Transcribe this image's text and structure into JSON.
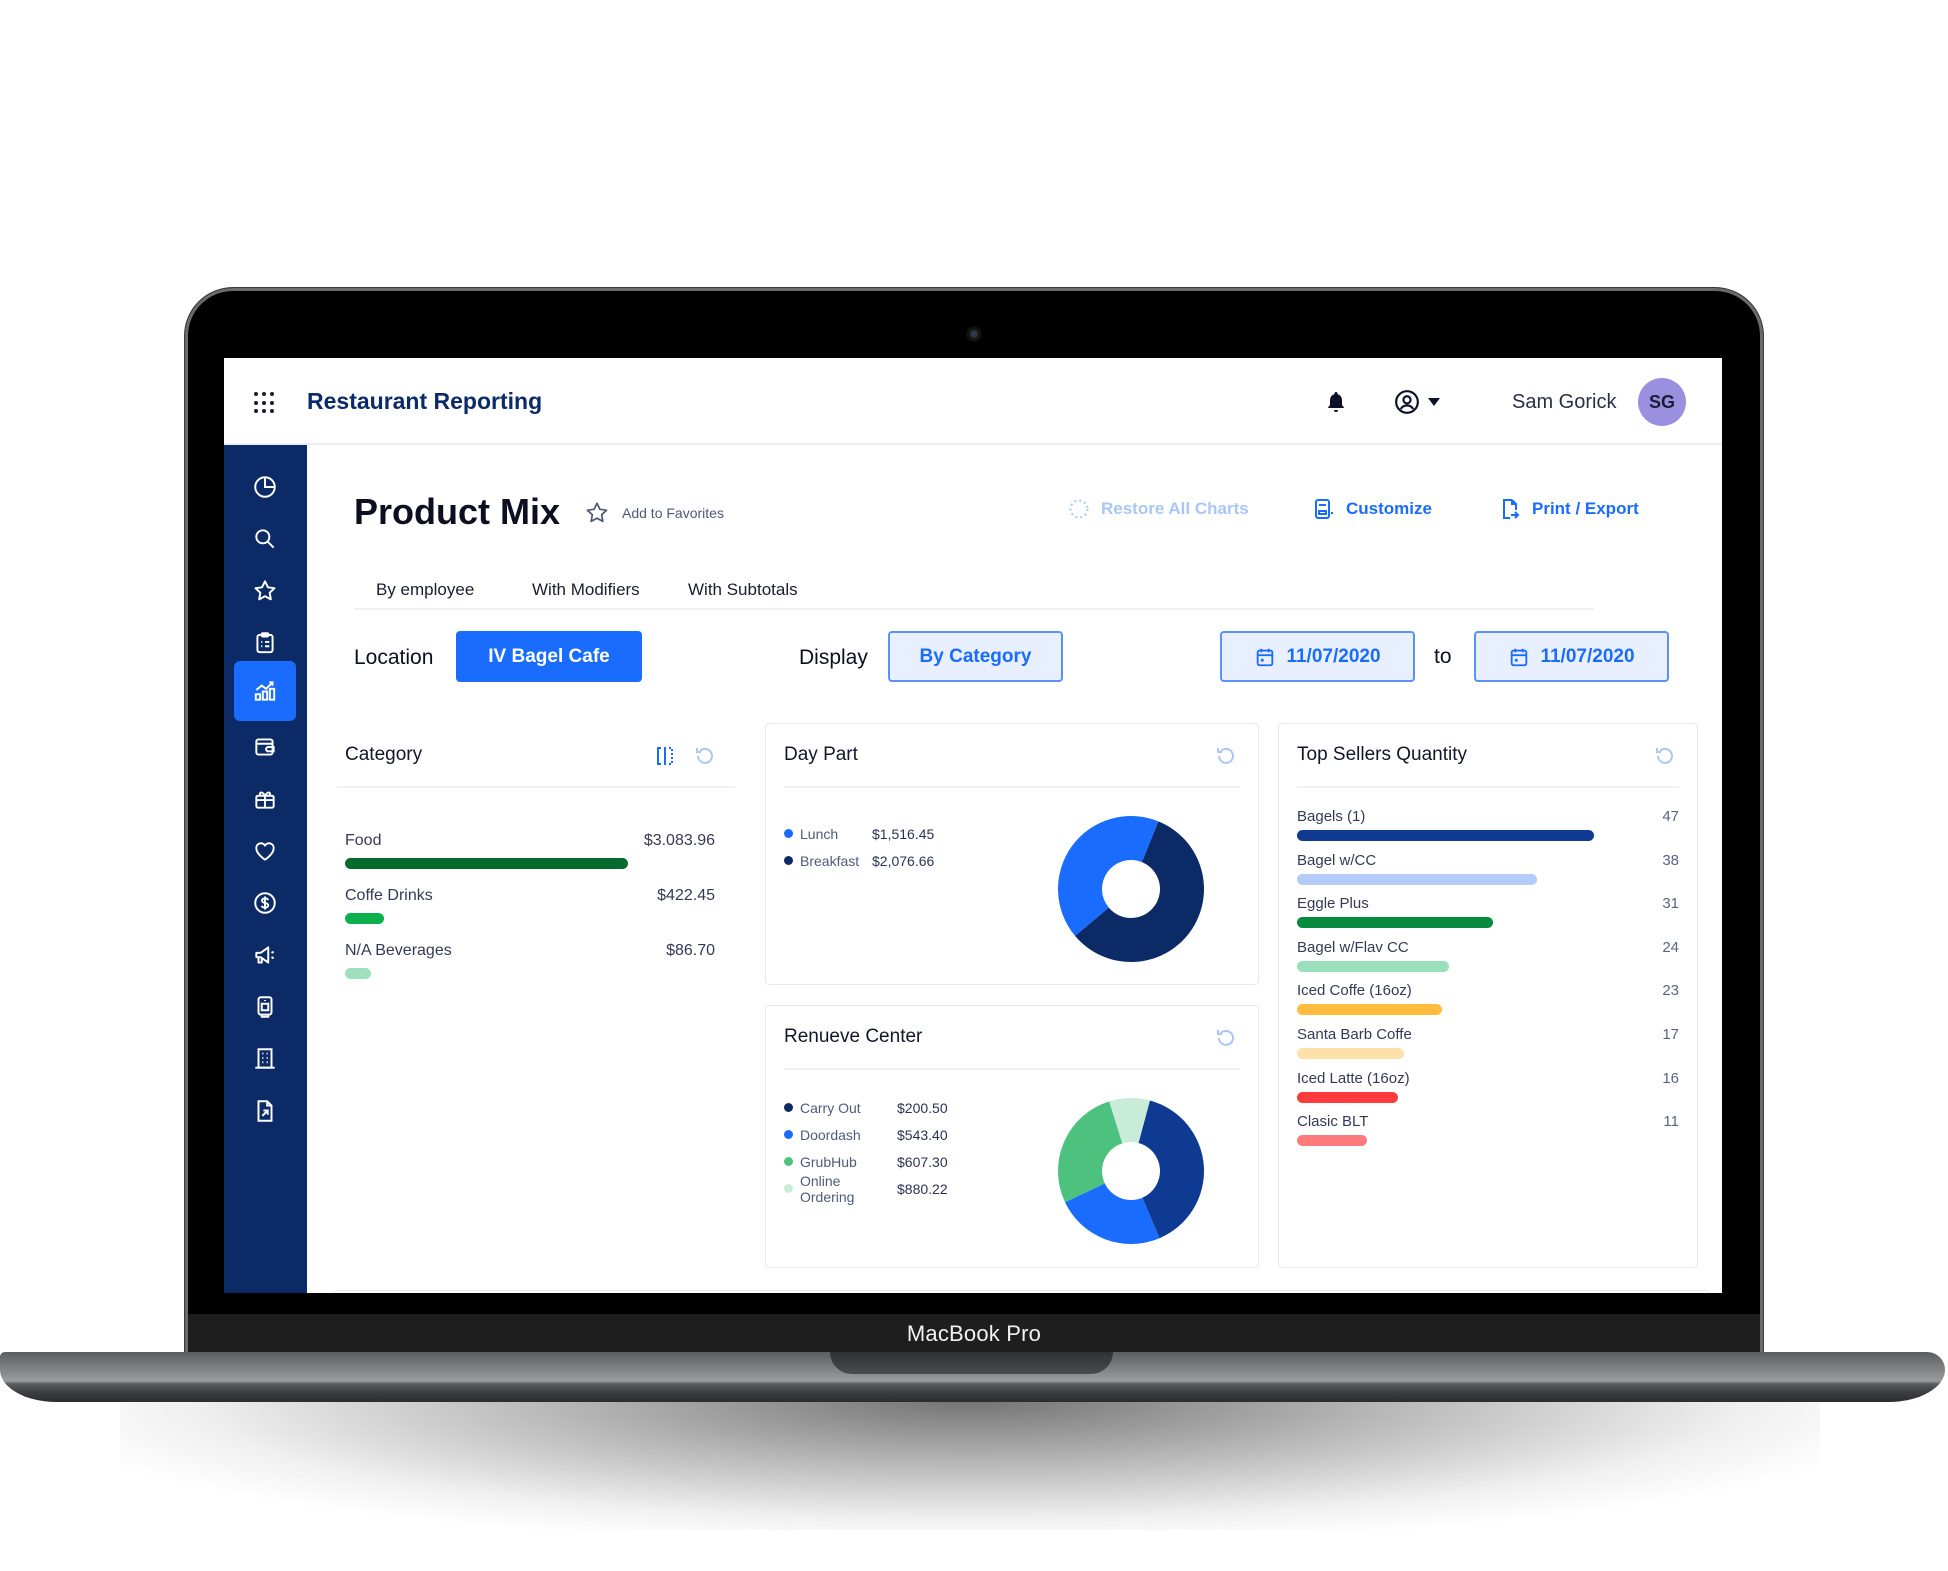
{
  "device": {
    "label": "MacBook Pro"
  },
  "header": {
    "app_title": "Restaurant Reporting",
    "user_name": "Sam Gorick",
    "avatar_initials": "SG",
    "avatar_color": "#9b8fe0"
  },
  "sidebar": {
    "items": [
      {
        "icon": "pie-chart-icon",
        "active": false
      },
      {
        "icon": "search-icon",
        "active": false
      },
      {
        "icon": "star-icon",
        "active": false
      },
      {
        "icon": "clipboard-icon",
        "active": false
      },
      {
        "icon": "analytics-icon",
        "active": true
      },
      {
        "icon": "wallet-icon",
        "active": false
      },
      {
        "icon": "gift-icon",
        "active": false
      },
      {
        "icon": "heart-icon",
        "active": false
      },
      {
        "icon": "dollar-icon",
        "active": false
      },
      {
        "icon": "megaphone-icon",
        "active": false
      },
      {
        "icon": "terminal-icon",
        "active": false
      },
      {
        "icon": "building-icon",
        "active": false
      },
      {
        "icon": "export-file-icon",
        "active": false
      }
    ]
  },
  "page": {
    "title": "Product Mix",
    "favorite_label": "Add to Favorites",
    "actions": {
      "restore": "Restore All Charts",
      "customize": "Customize",
      "export": "Print / Export"
    },
    "tabs": [
      "By employee",
      "With Modifiers",
      "With Subtotals"
    ],
    "filters": {
      "location_label": "Location",
      "location_value": "IV Bagel Cafe",
      "display_label": "Display",
      "display_value": "By Category",
      "date_from": "11/07/2020",
      "to_label": "to",
      "date_to": "11/07/2020"
    }
  },
  "colors": {
    "brand_navy": "#0b2a66",
    "accent_blue": "#1a6cff"
  },
  "chart_data": [
    {
      "type": "bar",
      "title": "Category",
      "orientation": "horizontal",
      "categories": [
        "Food",
        "Coffe Drinks",
        "N/A Beverages"
      ],
      "value_labels": [
        "$3.083.96",
        "$422.45",
        "$86.70"
      ],
      "values": [
        3083.96,
        422.45,
        86.7
      ],
      "colors": [
        "#046a2e",
        "#0bb04c",
        "#9ee0be"
      ]
    },
    {
      "type": "pie",
      "title": "Day Part",
      "donut": true,
      "categories": [
        "Lunch",
        "Breakfast"
      ],
      "value_labels": [
        "$1,516.45",
        "$2,076.66"
      ],
      "values": [
        1516.45,
        2076.66
      ],
      "colors": [
        "#1a6cff",
        "#0b2a66"
      ]
    },
    {
      "type": "pie",
      "title": "Renueve Center",
      "donut": true,
      "categories": [
        "Carry Out",
        "Doordash",
        "GrubHub",
        "Online Ordering"
      ],
      "value_labels": [
        "$200.50",
        "$543.40",
        "$607.30",
        "$880.22"
      ],
      "values": [
        200.5,
        543.4,
        607.3,
        880.22
      ],
      "colors": [
        "#0b2a66",
        "#1a6cff",
        "#4cc27e",
        "#c9ecd9"
      ],
      "slice_colors_drawn": [
        "#0e3a92",
        "#1a6cff",
        "#4cc27e",
        "#c9ecd9"
      ]
    },
    {
      "type": "bar",
      "title": "Top Sellers Quantity",
      "orientation": "horizontal",
      "categories": [
        "Bagels (1)",
        "Bagel w/CC",
        "Eggle Plus",
        "Bagel w/Flav CC",
        "Iced Coffe (16oz)",
        "Santa Barb Coffe",
        "Iced Latte (16oz)",
        "Clasic BLT"
      ],
      "values": [
        47,
        38,
        31,
        24,
        23,
        17,
        16,
        11
      ],
      "colors": [
        "#0e3a92",
        "#b3ccf9",
        "#068a3e",
        "#9adfbb",
        "#ffbc3d",
        "#ffe0a8",
        "#ff3b3b",
        "#ff7a7a"
      ]
    }
  ]
}
